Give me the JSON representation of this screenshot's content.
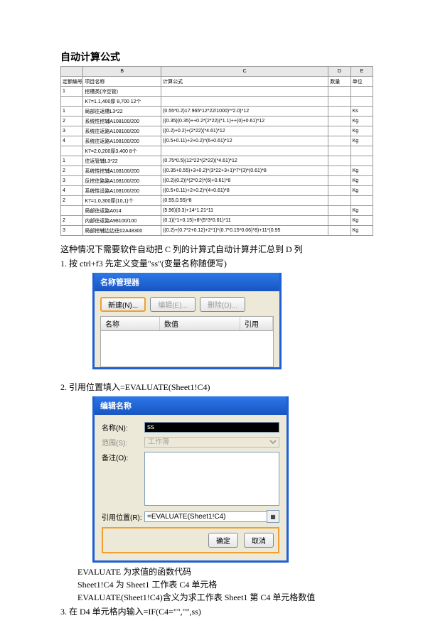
{
  "title": "自动计算公式",
  "table": {
    "headers": {
      "a": "",
      "b": "B",
      "c": "C",
      "d": "D",
      "e": "E"
    },
    "subheaders": {
      "a": "定额编号",
      "b": "项目名称",
      "c": "计算公式",
      "d": "数量",
      "e": "单位"
    },
    "rows": [
      {
        "a": "1",
        "b": "挖槽类(冷空管)",
        "c": "",
        "d": "",
        "e": ""
      },
      {
        "a": "",
        "b": "K7=1.1,400厚 8,700 12个",
        "c": "",
        "d": "",
        "e": ""
      },
      {
        "a": "1",
        "b": "局部往返槽L3*22",
        "c": "(0.55*0.2)17.965*12*22/1000)**2.0)*12",
        "d": "",
        "e": "Ks"
      },
      {
        "a": "2",
        "b": "系统性挖辅A108100/200",
        "c": "((0.35)(0.35)++0.2*(2*22)(*1.1)++(0)+0.61)*12",
        "d": "",
        "e": "Kg"
      },
      {
        "a": "3",
        "b": "系统往返路A108100/200",
        "c": "((0.2)+0.2)+(2*22)(*4.61)*12",
        "d": "",
        "e": "Kg"
      },
      {
        "a": "4",
        "b": "系统往返路A108100/200",
        "c": "((0.5+0.11)+2+0.2)*(6+0.61)*12",
        "d": "",
        "e": "Kg"
      },
      {
        "a": "",
        "b": "K7=2.0,200厚3,400 8个",
        "c": "",
        "d": "",
        "e": ""
      },
      {
        "a": "1",
        "b": "往返管辅L3*22",
        "c": "(0.75*0.5)(12*22*(2*22)(*4.61)*12",
        "d": "",
        "e": ""
      },
      {
        "a": "2",
        "b": "系统性挖辅A108100/200",
        "c": "((0.35+0.55)+3+0.2)*(3*22+3+1)*7*(3)*(0.61)*8",
        "d": "",
        "e": "Kg"
      },
      {
        "a": "3",
        "b": "反挖往路路A108100/200",
        "c": "((0.2)(0.2))*(2*0.2)*(6)+0.61)*8",
        "d": "",
        "e": "Kg"
      },
      {
        "a": "4",
        "b": "系统性设路A108100/200",
        "c": "((0.5+0.11)+2+0.2)*(4+0.61)*8",
        "d": "",
        "e": "Kg"
      },
      {
        "a": "2",
        "b": "K7=1.0,300厚(10,1)个",
        "c": "(0.55,0.55)*8",
        "d": "",
        "e": ""
      },
      {
        "a": "",
        "b": "局部往返路A014",
        "c": "(5.96)(0.3)+14*1.21*11",
        "d": "",
        "e": "Kg"
      },
      {
        "a": "2",
        "b": "内部往返路A98100/100",
        "c": "(0.1)(*1+0.15)+8*(5*3*0.61)*11",
        "d": "",
        "e": "Kg"
      },
      {
        "a": "3",
        "b": "局部挖辅边边往02A48300",
        "c": "((0.2)+(0.7*2+0.12)+2*1)*(0.7*0.15*0.06)*8)+11*(0.95",
        "d": "",
        "e": "Kg"
      }
    ]
  },
  "desc": "这种情况下需要软件自动把 C 列的计算式自动计算并汇总到 D 列",
  "step1": "1. 按 ctrl+f3 先定义变量\"ss\"(变量名称随便写)",
  "dlg1": {
    "title": "名称管理器",
    "new": "新建(N)...",
    "edit": "编辑(E)...",
    "delete": "删除(D)...",
    "col_name": "名称",
    "col_value": "数值",
    "col_ref": "引用"
  },
  "step2": "2. 引用位置填入=EVALUATE(Sheet1!C4)",
  "dlg2": {
    "title": "编辑名称",
    "name_label": "名称(N):",
    "name_value": "ss",
    "scope_label": "范围(S):",
    "scope_value": "工作簿",
    "comment_label": "备注(O):",
    "ref_label": "引用位置(R):",
    "ref_value": "=EVALUATE(Sheet1!C4)",
    "ok": "确定",
    "cancel": "取消"
  },
  "notes": {
    "n1": "EVALUATE 为求值的函数代码",
    "n2": "Sheet1!C4 为 Sheet1 工作表 C4 单元格",
    "n3": "EVALUATE(Sheet1!C4)含义为求工作表 Sheet1 第 C4 单元格数值"
  },
  "step3": "3. 在 D4 单元格内输入=IF(C4=\"\",\"\",ss)"
}
